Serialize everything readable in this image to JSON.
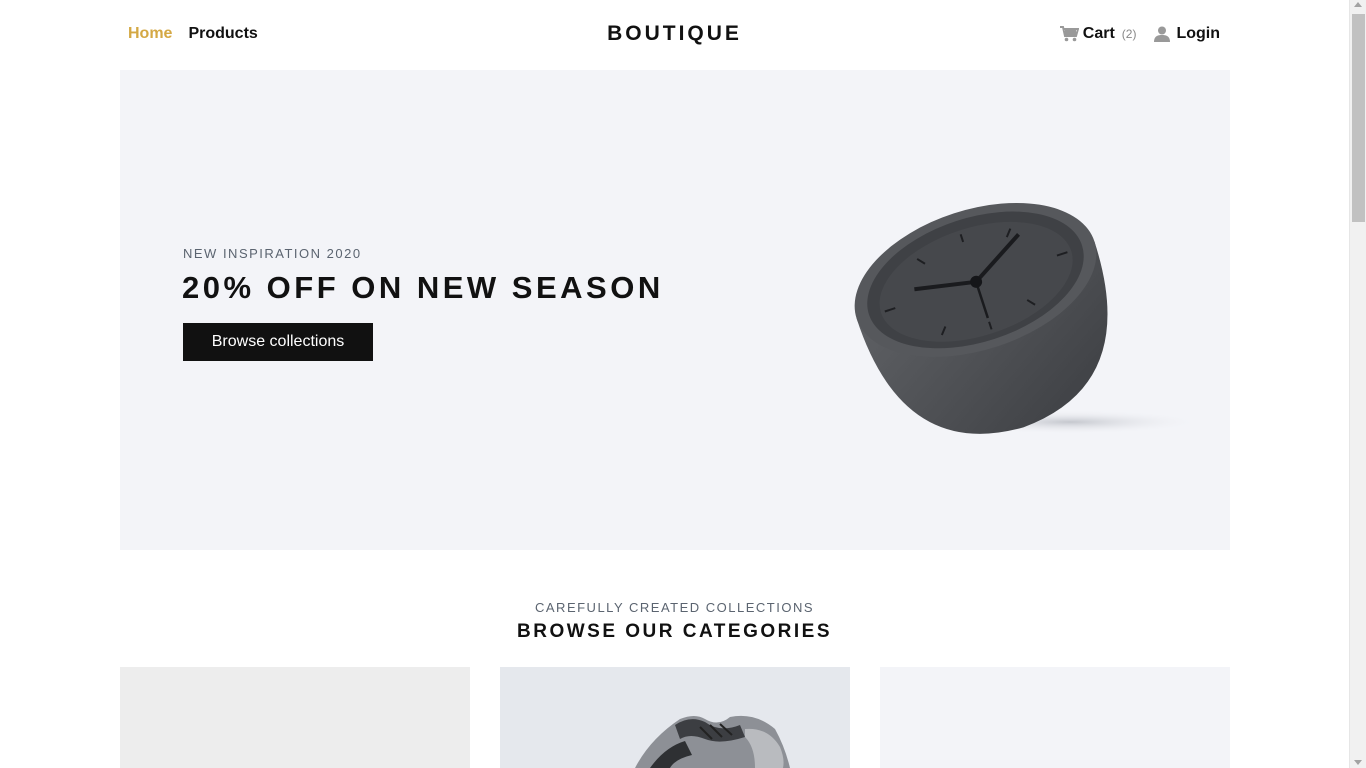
{
  "nav": {
    "home_label": "Home",
    "products_label": "Products",
    "brand": "BOUTIQUE",
    "cart_label": "Cart",
    "cart_count": "(2)",
    "login_label": "Login",
    "icons": {
      "cart": "cart-icon",
      "user": "user-icon"
    },
    "active_color": "#d4a844"
  },
  "hero": {
    "kicker": "NEW INSPIRATION 2020",
    "title": "20% OFF ON NEW SEASON",
    "button_label": "Browse collections",
    "image": "clock-product-image",
    "background": "#f3f4f8"
  },
  "categories": {
    "kicker": "CAREFULLY CREATED COLLECTIONS",
    "title": "BROWSE OUR CATEGORIES",
    "cards": [
      {
        "image": "category-image-1"
      },
      {
        "image": "sneaker-category-image"
      },
      {
        "image": "category-image-3"
      }
    ]
  }
}
